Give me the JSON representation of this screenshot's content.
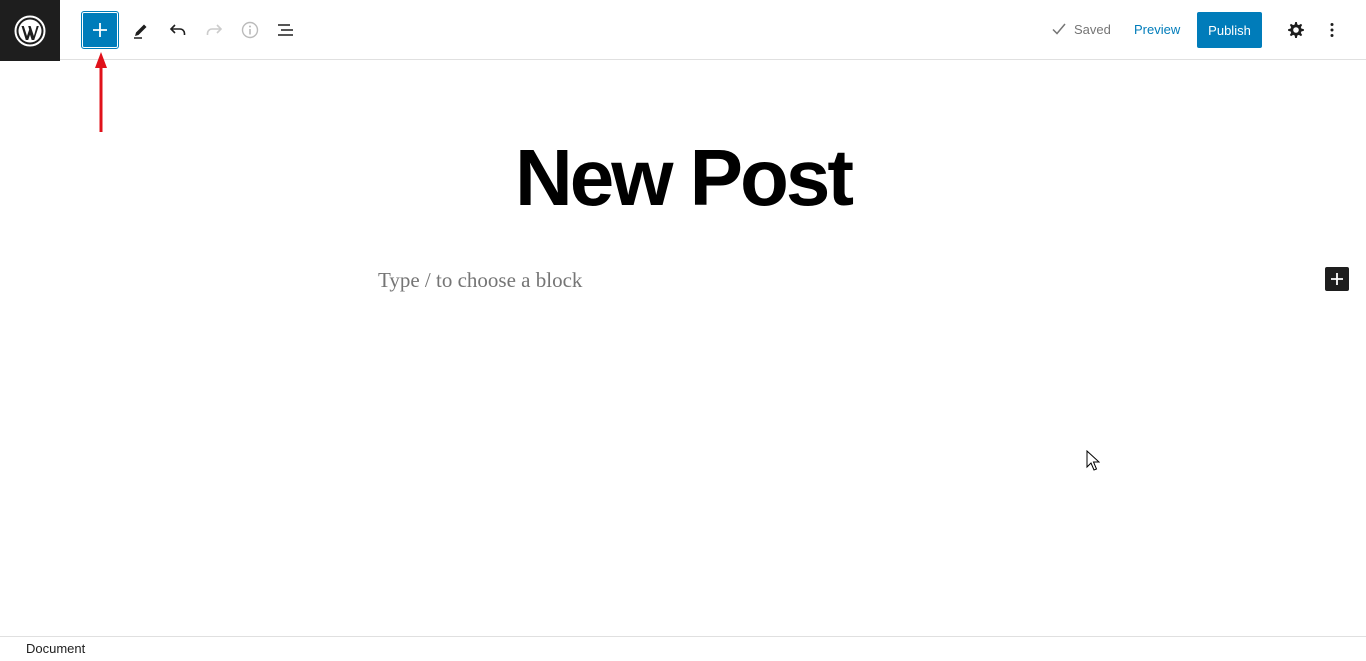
{
  "toolbar": {
    "saved_label": "Saved",
    "preview_label": "Preview",
    "publish_label": "Publish"
  },
  "editor": {
    "title": "New Post",
    "block_placeholder": "Type / to choose a block"
  },
  "footer": {
    "breadcrumb": "Document"
  },
  "icons": {
    "logo": "wordpress-logo-icon",
    "inserter": "plus-icon",
    "tools": "pencil-icon",
    "undo": "undo-icon",
    "redo": "redo-icon",
    "details": "info-icon",
    "outline": "list-view-icon",
    "settings": "gear-icon",
    "more": "more-vertical-icon"
  },
  "colors": {
    "accent": "#007cba",
    "dark": "#1e1e1e",
    "annotation_arrow": "#e0111a"
  }
}
